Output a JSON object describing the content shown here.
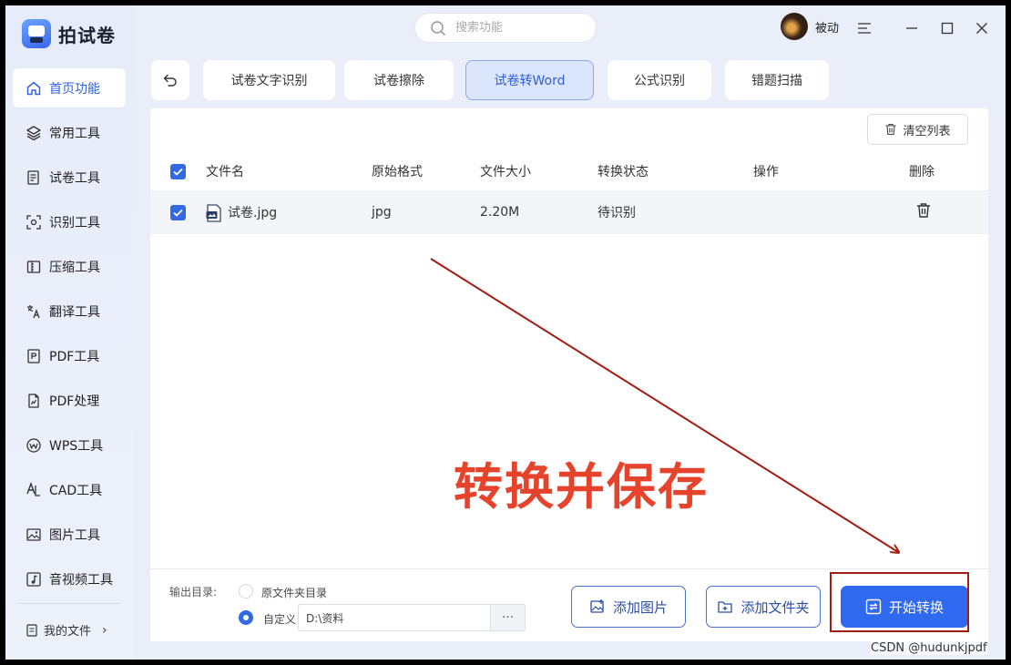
{
  "app": {
    "name": "拍试卷",
    "search_placeholder": "搜索功能",
    "user_name": "被动"
  },
  "sidebar": {
    "items": [
      {
        "label": "首页功能",
        "icon": "home-icon",
        "active": true
      },
      {
        "label": "常用工具",
        "icon": "layers-icon"
      },
      {
        "label": "试卷工具",
        "icon": "paper-icon"
      },
      {
        "label": "识别工具",
        "icon": "scan-icon"
      },
      {
        "label": "压缩工具",
        "icon": "compress-icon"
      },
      {
        "label": "翻译工具",
        "icon": "translate-icon"
      },
      {
        "label": "PDF工具",
        "icon": "pdf-icon"
      },
      {
        "label": "PDF处理",
        "icon": "pdf-edit-icon"
      },
      {
        "label": "WPS工具",
        "icon": "wps-icon"
      },
      {
        "label": "CAD工具",
        "icon": "cad-icon"
      },
      {
        "label": "图片工具",
        "icon": "image-icon"
      },
      {
        "label": "音视频工具",
        "icon": "music-icon"
      }
    ],
    "my_files": "我的文件"
  },
  "tabs": [
    {
      "label": "试卷文字识别"
    },
    {
      "label": "试卷擦除"
    },
    {
      "label": "试卷转Word",
      "active": true
    },
    {
      "label": "公式识别"
    },
    {
      "label": "错题扫描"
    }
  ],
  "toolbar": {
    "clear_list": "清空列表"
  },
  "table": {
    "headers": {
      "filename": "文件名",
      "format": "原始格式",
      "size": "文件大小",
      "status": "转换状态",
      "action": "操作",
      "delete": "删除"
    },
    "rows": [
      {
        "filename": "试卷.jpg",
        "format": "jpg",
        "size": "2.20M",
        "status": "待识别",
        "checked": true
      }
    ]
  },
  "annotation": {
    "text": "转换并保存",
    "color": "#e5432c"
  },
  "output": {
    "label": "输出目录:",
    "option_original": "原文件夹目录",
    "option_custom": "自定义",
    "path": "D:\\资料",
    "more": "···"
  },
  "buttons": {
    "add_image": "添加图片",
    "add_folder": "添加文件夹",
    "start": "开始转换"
  },
  "watermark": "CSDN @hudunkjpdf",
  "colors": {
    "accent": "#2e69ef",
    "annotation_box": "#a31c12"
  }
}
